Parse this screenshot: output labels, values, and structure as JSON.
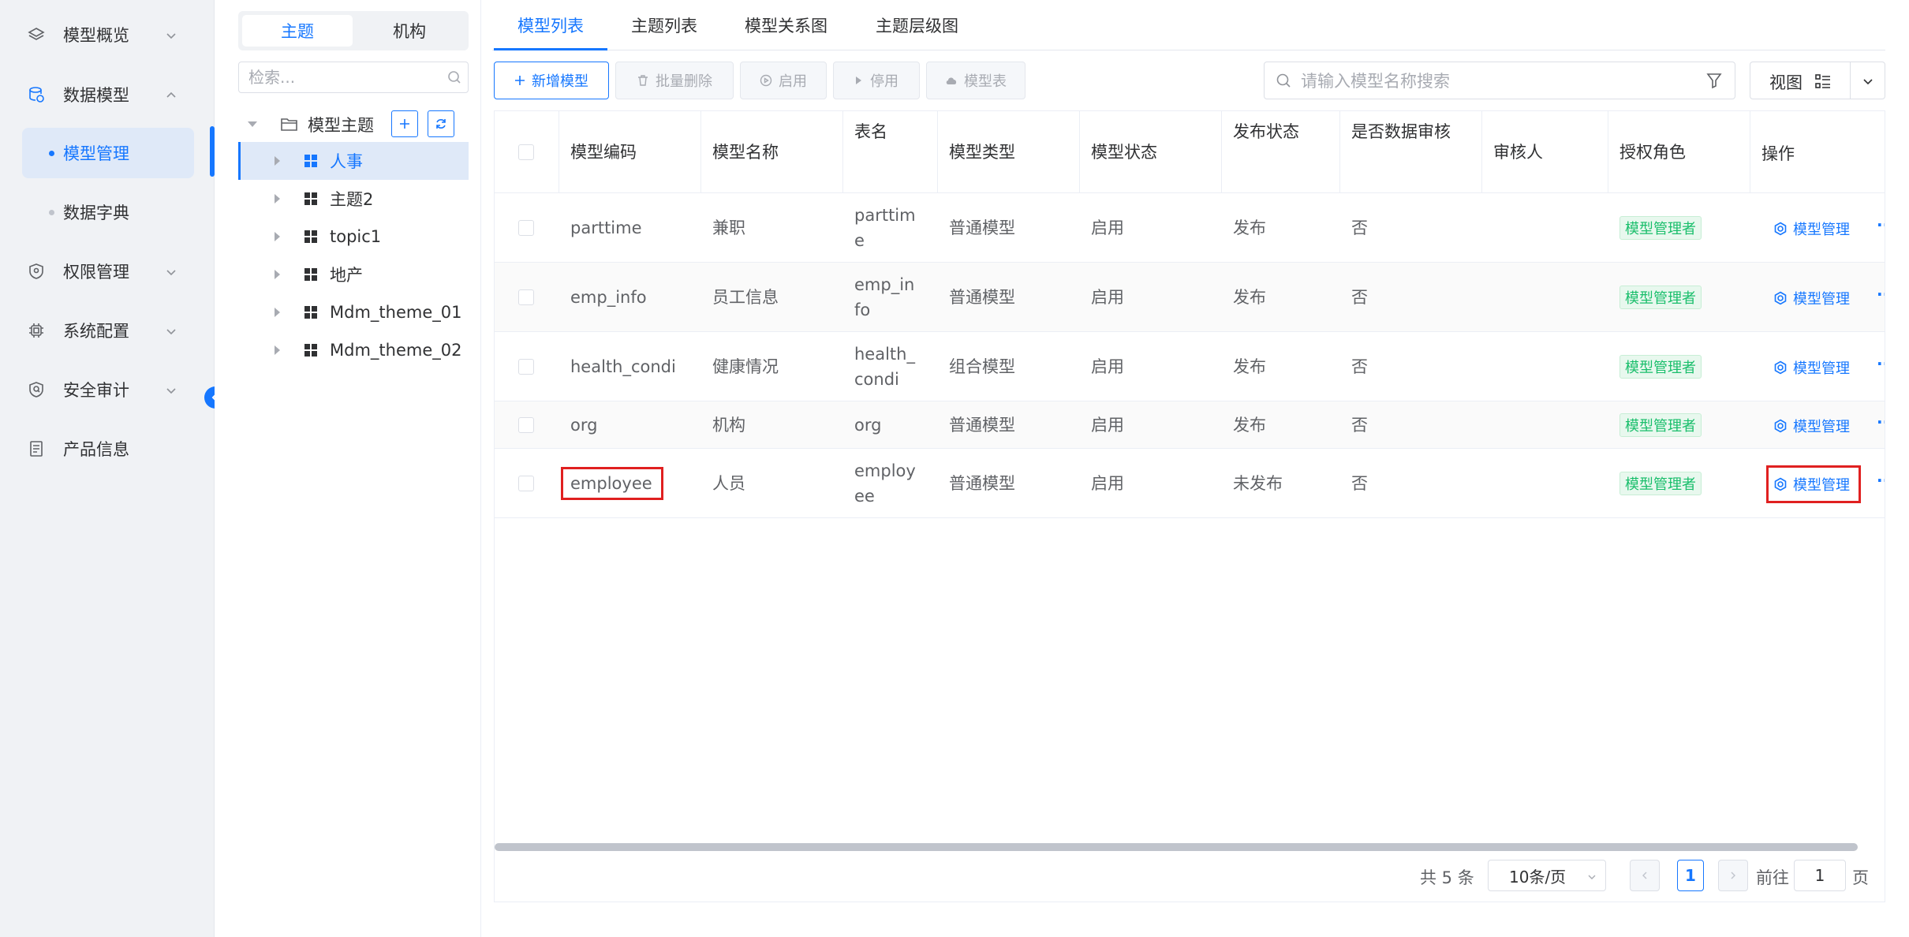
{
  "sidebar": {
    "items": [
      {
        "label": "模型概览",
        "icon": "layers-icon",
        "expanded": false
      },
      {
        "label": "数据模型",
        "icon": "database-icon",
        "expanded": true
      },
      {
        "label": "权限管理",
        "icon": "shield-icon",
        "expanded": false
      },
      {
        "label": "系统配置",
        "icon": "chip-icon",
        "expanded": false
      },
      {
        "label": "安全审计",
        "icon": "audit-shield-icon",
        "expanded": false
      },
      {
        "label": "产品信息",
        "icon": "document-icon",
        "expanded": false
      }
    ],
    "sub_items": [
      {
        "label": "模型管理",
        "active": true
      },
      {
        "label": "数据字典",
        "active": false
      }
    ]
  },
  "tree_panel": {
    "segments": [
      "主题",
      "机构"
    ],
    "active_segment": "主题",
    "search_placeholder": "检索...",
    "root_label": "模型主题",
    "nodes": [
      "人事",
      "主题2",
      "topic1",
      "地产",
      "Mdm_theme_01",
      "Mdm_theme_02"
    ],
    "selected_node": "人事"
  },
  "tabs": [
    "模型列表",
    "主题列表",
    "模型关系图",
    "主题层级图"
  ],
  "active_tab": "模型列表",
  "toolbar": {
    "add_label": "新增模型",
    "batch_delete_label": "批量删除",
    "enable_label": "启用",
    "disable_label": "停用",
    "model_table_label": "模型表",
    "search_placeholder": "请输入模型名称搜索",
    "view_label": "视图"
  },
  "table": {
    "headers": [
      "模型编码",
      "模型名称",
      "表名",
      "模型类型",
      "模型状态",
      "发布状态",
      "是否数据审核",
      "审核人",
      "授权角色",
      "操作"
    ],
    "rows": [
      {
        "code": "parttime",
        "name": "兼职",
        "table_l1": "parttim",
        "table_l2": "e",
        "type": "普通模型",
        "status": "启用",
        "publish": "发布",
        "audit": "否",
        "reviewer": "",
        "role": "模型管理者",
        "op": "模型管理"
      },
      {
        "code": "emp_info",
        "name": "员工信息",
        "table_l1": "emp_in",
        "table_l2": "fo",
        "type": "普通模型",
        "status": "启用",
        "publish": "发布",
        "audit": "否",
        "reviewer": "",
        "role": "模型管理者",
        "op": "模型管理"
      },
      {
        "code": "health_condi",
        "name": "健康情况",
        "table_l1": "health_",
        "table_l2": "condi",
        "type": "组合模型",
        "status": "启用",
        "publish": "发布",
        "audit": "否",
        "reviewer": "",
        "role": "模型管理者",
        "op": "模型管理"
      },
      {
        "code": "org",
        "name": "机构",
        "table_l1": "org",
        "table_l2": "",
        "type": "普通模型",
        "status": "启用",
        "publish": "发布",
        "audit": "否",
        "reviewer": "",
        "role": "模型管理者",
        "op": "模型管理"
      },
      {
        "code": "employee",
        "name": "人员",
        "table_l1": "employ",
        "table_l2": "ee",
        "type": "普通模型",
        "status": "启用",
        "publish": "未发布",
        "audit": "否",
        "reviewer": "",
        "role": "模型管理者",
        "op": "模型管理"
      }
    ]
  },
  "pagination": {
    "total_text": "共 5 条",
    "page_size": "10条/页",
    "current_page": "1",
    "goto_label": "前往",
    "goto_value": "1",
    "page_suffix": "页"
  },
  "colors": {
    "accent": "#1677ff",
    "tag_green": "#19be6b",
    "highlight_red": "#e02020"
  }
}
